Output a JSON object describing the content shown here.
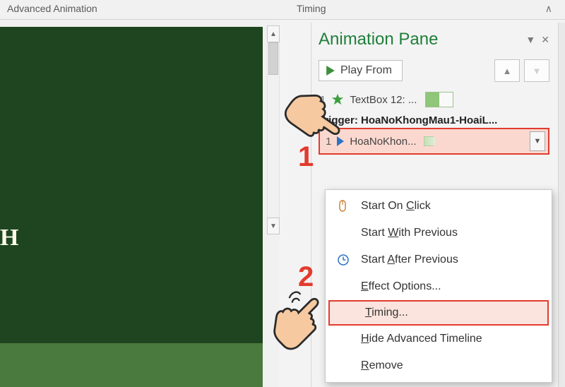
{
  "ribbon": {
    "adv_group_label": "Advanced Animation",
    "timing_group_label": "Timing"
  },
  "slide": {
    "visible_text": "H"
  },
  "pane": {
    "title": "Animation Pane",
    "play_button": "Play From",
    "item1": {
      "index": "1",
      "label": "TextBox 12: ..."
    },
    "trigger_header": "Trigger: HoaNoKhongMau1-HoaiL...",
    "trigger_item": {
      "index": "1",
      "label": "HoaNoKhon..."
    }
  },
  "context_menu": {
    "start_on_click": "Start On Click",
    "start_with_previous": "Start With Previous",
    "start_after_previous": "Start After Previous",
    "effect_options": "Effect Options...",
    "timing": "Timing...",
    "hide_advanced": "Hide Advanced Timeline",
    "remove": "Remove",
    "underlines": {
      "start_on_click_key": "C",
      "start_with_previous_key": "W",
      "start_after_previous_key": "A",
      "effect_options_key": "E",
      "timing_key": "T",
      "hide_advanced_key": "H",
      "remove_key": "R"
    }
  },
  "callouts": {
    "one": "1",
    "two": "2"
  }
}
